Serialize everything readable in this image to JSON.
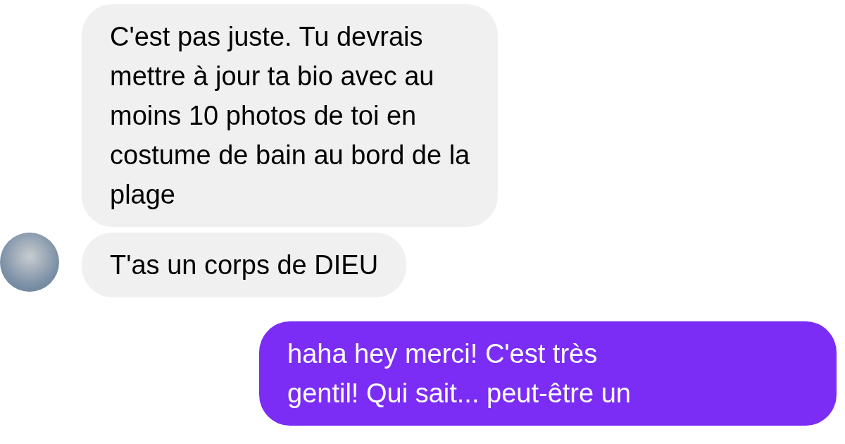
{
  "messages": [
    {
      "kind": "incoming",
      "avatar": false,
      "lines": [
        "C'est pas juste. Tu devrais",
        "mettre à jour ta bio avec au",
        "moins 10 photos de toi en",
        "costume de bain au bord de la",
        "plage"
      ]
    },
    {
      "kind": "incoming",
      "avatar": true,
      "lines": [
        "T'as un corps de DIEU"
      ]
    },
    {
      "kind": "outgoing",
      "lines": [
        "haha hey merci! C'est très",
        "gentil! Qui sait... peut-être un"
      ]
    }
  ]
}
